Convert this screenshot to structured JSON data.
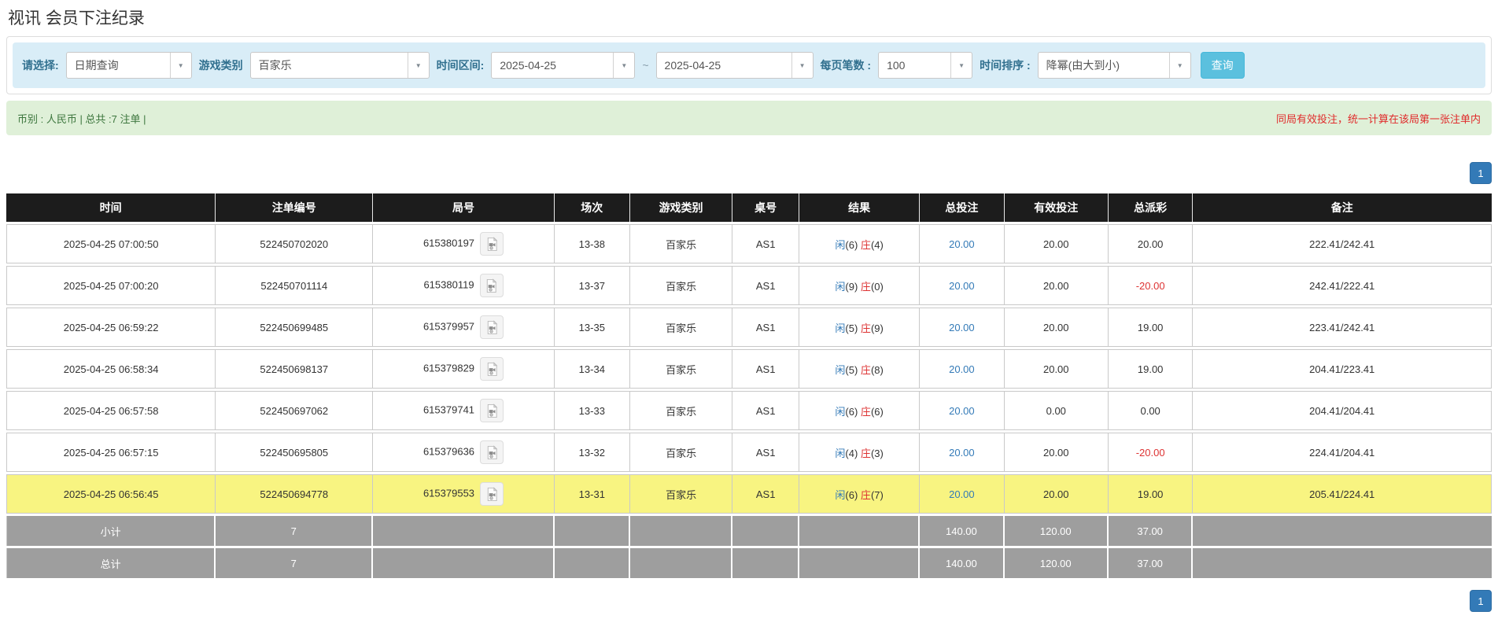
{
  "page_title": "视讯 会员下注纪录",
  "filters": {
    "query_type": {
      "label": "请选择:",
      "value": "日期查询"
    },
    "game_category": {
      "label": "游戏类别",
      "value": "百家乐"
    },
    "time_range": {
      "label": "时间区间:",
      "from": "2025-04-25",
      "separator": "~",
      "to": "2025-04-25"
    },
    "page_size": {
      "label": "每页笔数 :",
      "value": "100"
    },
    "time_sort": {
      "label": "时间排序 :",
      "value": "降幂(由大到小)"
    },
    "search_button": "查询"
  },
  "summary_bar": {
    "left_text": "币别 : 人民币 | 总共 :7 注单 |",
    "right_text": "同局有效投注，统一计算在该局第一张注单内"
  },
  "pagination": {
    "page": "1"
  },
  "icons": {
    "round_replay": "video-file-icon",
    "select_arrow": "chevron-down-icon"
  },
  "table": {
    "headers": [
      "时间",
      "注单编号",
      "局号",
      "场次",
      "游戏类别",
      "桌号",
      "结果",
      "总投注",
      "有效投注",
      "总派彩",
      "备注"
    ],
    "rows": [
      {
        "time": "2025-04-25 07:00:50",
        "bet_id": "522450702020",
        "round": "615380197",
        "session": "13-38",
        "game": "百家乐",
        "table_no": "AS1",
        "result": {
          "player_label": "闲",
          "player_score": "(6)",
          "banker_label": "庄",
          "banker_score": "(4)"
        },
        "total_bet": "20.00",
        "valid_bet": "20.00",
        "payout": "20.00",
        "remark": "222.41/242.41",
        "highlight": false
      },
      {
        "time": "2025-04-25 07:00:20",
        "bet_id": "522450701114",
        "round": "615380119",
        "session": "13-37",
        "game": "百家乐",
        "table_no": "AS1",
        "result": {
          "player_label": "闲",
          "player_score": "(9)",
          "banker_label": "庄",
          "banker_score": "(0)"
        },
        "total_bet": "20.00",
        "valid_bet": "20.00",
        "payout": "-20.00",
        "remark": "242.41/222.41",
        "highlight": false
      },
      {
        "time": "2025-04-25 06:59:22",
        "bet_id": "522450699485",
        "round": "615379957",
        "session": "13-35",
        "game": "百家乐",
        "table_no": "AS1",
        "result": {
          "player_label": "闲",
          "player_score": "(5)",
          "banker_label": "庄",
          "banker_score": "(9)"
        },
        "total_bet": "20.00",
        "valid_bet": "20.00",
        "payout": "19.00",
        "remark": "223.41/242.41",
        "highlight": false
      },
      {
        "time": "2025-04-25 06:58:34",
        "bet_id": "522450698137",
        "round": "615379829",
        "session": "13-34",
        "game": "百家乐",
        "table_no": "AS1",
        "result": {
          "player_label": "闲",
          "player_score": "(5)",
          "banker_label": "庄",
          "banker_score": "(8)"
        },
        "total_bet": "20.00",
        "valid_bet": "20.00",
        "payout": "19.00",
        "remark": "204.41/223.41",
        "highlight": false
      },
      {
        "time": "2025-04-25 06:57:58",
        "bet_id": "522450697062",
        "round": "615379741",
        "session": "13-33",
        "game": "百家乐",
        "table_no": "AS1",
        "result": {
          "player_label": "闲",
          "player_score": "(6)",
          "banker_label": "庄",
          "banker_score": "(6)"
        },
        "total_bet": "20.00",
        "valid_bet": "0.00",
        "payout": "0.00",
        "remark": "204.41/204.41",
        "highlight": false
      },
      {
        "time": "2025-04-25 06:57:15",
        "bet_id": "522450695805",
        "round": "615379636",
        "session": "13-32",
        "game": "百家乐",
        "table_no": "AS1",
        "result": {
          "player_label": "闲",
          "player_score": "(4)",
          "banker_label": "庄",
          "banker_score": "(3)"
        },
        "total_bet": "20.00",
        "valid_bet": "20.00",
        "payout": "-20.00",
        "remark": "224.41/204.41",
        "highlight": false
      },
      {
        "time": "2025-04-25 06:56:45",
        "bet_id": "522450694778",
        "round": "615379553",
        "session": "13-31",
        "game": "百家乐",
        "table_no": "AS1",
        "result": {
          "player_label": "闲",
          "player_score": "(6)",
          "banker_label": "庄",
          "banker_score": "(7)"
        },
        "total_bet": "20.00",
        "valid_bet": "20.00",
        "payout": "19.00",
        "remark": "205.41/224.41",
        "highlight": true
      }
    ],
    "subtotal": {
      "label": "小计",
      "count": "7",
      "total_bet": "140.00",
      "valid_bet": "120.00",
      "payout": "37.00"
    },
    "total": {
      "label": "总计",
      "count": "7",
      "total_bet": "140.00",
      "valid_bet": "120.00",
      "payout": "37.00"
    }
  },
  "colors": {
    "accent": "#5bc0de",
    "pagination-blue": "#337ab7",
    "link-blue": "#337ab7",
    "header-bg": "#1c1c1c",
    "summary-gray": "#9e9e9e",
    "highlight-yellow": "#f8f481",
    "negative-red": "#dd3333",
    "notice-red": "#e02b2b",
    "success-bg": "#dff0d8",
    "success-text": "#3c763d",
    "info-bg": "#d9edf7",
    "label-blue": "#31708f"
  }
}
